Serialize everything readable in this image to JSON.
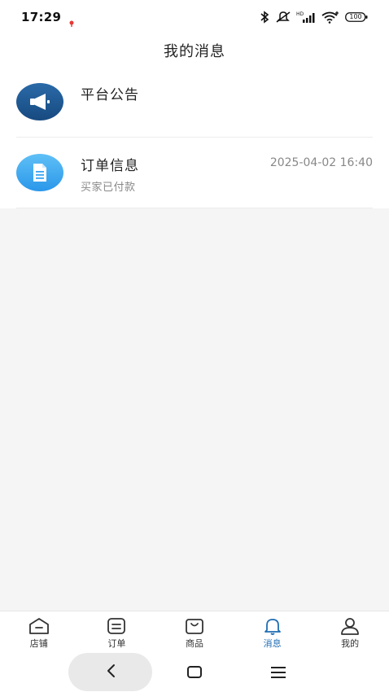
{
  "status_bar": {
    "time": "17:29",
    "battery": "100",
    "icons": [
      "notification-dot-icon",
      "bluetooth-icon",
      "mute-icon",
      "hd-signal-icon",
      "wifi-icon",
      "battery-icon"
    ]
  },
  "header": {
    "title": "我的消息"
  },
  "messages": [
    {
      "title": "平台公告",
      "subtitle": "",
      "time": "",
      "icon": "megaphone-icon",
      "icon_color": "#1f5b96"
    },
    {
      "title": "订单信息",
      "subtitle": "买家已付款",
      "time": "2025-04-02 16:40",
      "icon": "document-icon",
      "icon_color": "#3aa6f0"
    }
  ],
  "bottom_nav": {
    "active": "消息",
    "accent": "#1f6db3",
    "items": [
      {
        "label": "店铺",
        "icon": "store-icon"
      },
      {
        "label": "订单",
        "icon": "order-icon"
      },
      {
        "label": "商品",
        "icon": "bag-icon"
      },
      {
        "label": "消息",
        "icon": "bell-icon"
      },
      {
        "label": "我的",
        "icon": "user-icon"
      }
    ]
  },
  "system_nav": {
    "icons": [
      "back-icon",
      "home-icon",
      "menu-icon"
    ]
  }
}
